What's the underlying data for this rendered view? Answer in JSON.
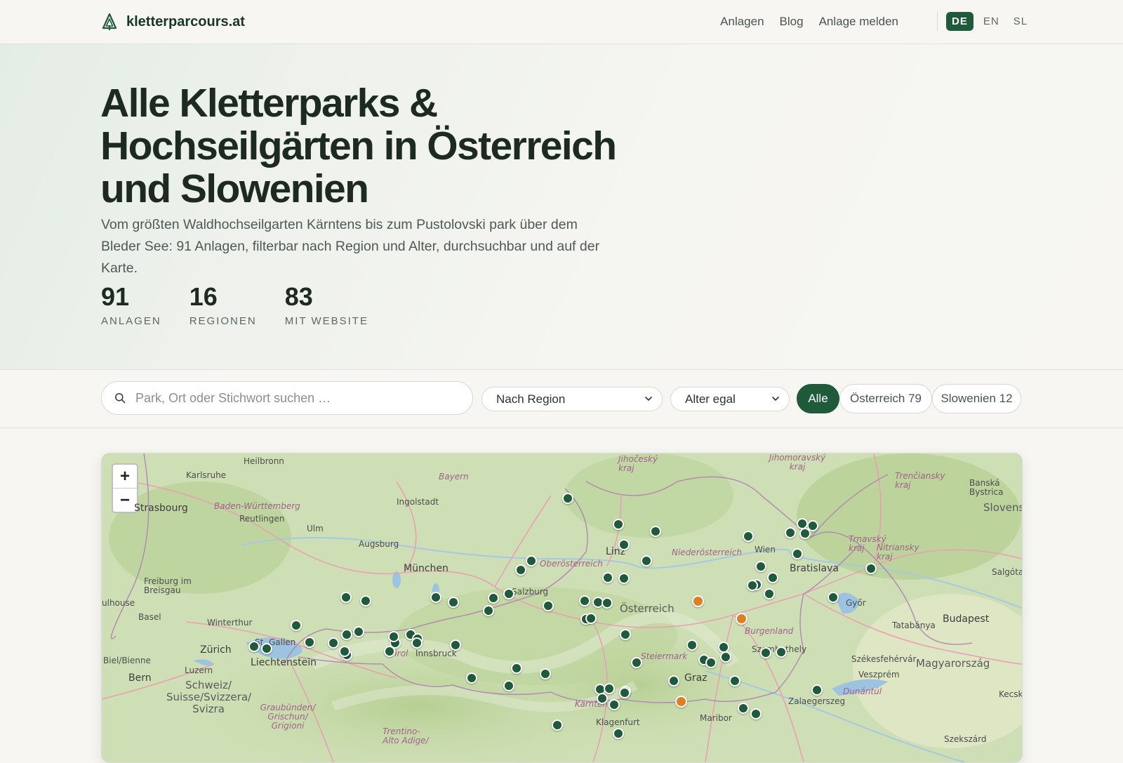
{
  "header": {
    "brand": "kletterparcours.at",
    "nav": [
      "Anlagen",
      "Blog",
      "Anlage melden"
    ],
    "languages": [
      {
        "code": "DE",
        "active": true
      },
      {
        "code": "EN",
        "active": false
      },
      {
        "code": "SL",
        "active": false
      }
    ]
  },
  "hero": {
    "title_line1": "Alle Kletterparks &",
    "title_line2": "Hochseilgärten in Österreich",
    "title_line3": "und Slowenien",
    "subtitle": "Vom größten Waldhochseilgarten Kärntens bis zum Pustolovski park über dem Bleder See: 91 Anlagen, filterbar nach Region und Alter, durchsuchbar und auf der Karte.",
    "stats": [
      {
        "value": "91",
        "label": "ANLAGEN"
      },
      {
        "value": "16",
        "label": "REGIONEN"
      },
      {
        "value": "83",
        "label": "MIT WEBSITE"
      }
    ]
  },
  "filters": {
    "search_placeholder": "Park, Ort oder Stichwort suchen …",
    "region_select": "Nach Region",
    "age_select": "Alter egal",
    "pills": [
      {
        "label": "Alle",
        "active": true
      },
      {
        "label": "Österreich 79",
        "active": false
      },
      {
        "label": "Slowenien 12",
        "active": false
      }
    ]
  },
  "map": {
    "zoom_in": "+",
    "zoom_out": "−",
    "labels": {
      "heilbronn": "Heilbronn",
      "karlsruhe": "Karlsruhe",
      "bayern": "Bayern",
      "ingolstadt": "Ingolstadt",
      "strasbourg": "Strasbourg",
      "bw": "Baden-Württemberg",
      "reutlingen": "Reutlingen",
      "ulm": "Ulm",
      "augsburg": "Augsburg",
      "muenchen": "München",
      "freiburg": "Freiburg im Breisgau",
      "mulhouse": "ulhouse",
      "basel": "Basel",
      "winterthur": "Winterthur",
      "zuerich": "Zürich",
      "stgallen": "St. Gallen",
      "liechtenstein": "Liechtenstein",
      "biel": "Biel/Bienne",
      "luzern": "Luzern",
      "bern": "Bern",
      "schweiz": "Schweiz/ Suisse/Svizzera/ Svizra",
      "graubuenden": "Graubünden/ Grischun/ Grigioni",
      "tirol": "Tirol",
      "innsbruck": "Innsbruck",
      "trentino": "Trentino- Alto Adige/",
      "salzburg": "Salzburg",
      "oberoesterreich": "Oberösterreich",
      "linz": "Linz",
      "oesterreich": "Österreich",
      "steiermark": "Steiermark",
      "graz": "Graz",
      "kaernten": "Kärnten",
      "klagenfurt": "Klagenfurt",
      "niederoesterreich": "Niederösterreich",
      "wien": "Wien",
      "bratislava": "Bratislava",
      "burgenland": "Burgenland",
      "szombathely": "Szombathely",
      "gyor": "Győr",
      "tatabanya": "Tatabánya",
      "budapest": "Budapest",
      "magyarorszag": "Magyarország",
      "szekesfehervar": "Székesfehérvár",
      "veszprem": "Veszprém",
      "dunantul": "Dunántúl",
      "zalaegerszeg": "Zalaegerszeg",
      "maribor": "Maribor",
      "kecskemet": "Kecskem",
      "szekszard": "Szekszárd",
      "jihocesky": "Jihočeský kraj",
      "jihomoravsky": "Jihomoravský kraj",
      "trnavsky": "Trnavský kraj",
      "nitriansky": "Nitriansky kraj",
      "trenciansky": "Trenčiansky kraj",
      "banska": "Banská Bystrica",
      "slovensk": "Slovensk",
      "salgota": "Salgóta"
    },
    "markers": [
      {
        "lon": 13.62,
        "lat": 48.73
      },
      {
        "lon": 14.25,
        "lat": 48.42
      },
      {
        "lon": 14.72,
        "lat": 48.34
      },
      {
        "lon": 14.32,
        "lat": 48.18
      },
      {
        "lon": 13.16,
        "lat": 47.99
      },
      {
        "lon": 14.61,
        "lat": 47.99
      },
      {
        "lon": 13.02,
        "lat": 47.88
      },
      {
        "lon": 14.12,
        "lat": 47.79
      },
      {
        "lon": 14.32,
        "lat": 47.78
      },
      {
        "lon": 15.89,
        "lat": 48.28
      },
      {
        "lon": 16.42,
        "lat": 48.32
      },
      {
        "lon": 16.7,
        "lat": 48.4
      },
      {
        "lon": 16.57,
        "lat": 48.43
      },
      {
        "lon": 16.61,
        "lat": 48.31
      },
      {
        "lon": 16.51,
        "lat": 48.07
      },
      {
        "lon": 16.05,
        "lat": 47.92
      },
      {
        "lon": 16.2,
        "lat": 47.79
      },
      {
        "lon": 16.0,
        "lat": 47.71
      },
      {
        "lon": 15.94,
        "lat": 47.7
      },
      {
        "lon": 16.16,
        "lat": 47.6
      },
      {
        "lon": 16.96,
        "lat": 47.56
      },
      {
        "lon": 17.44,
        "lat": 47.9
      },
      {
        "lon": 10.82,
        "lat": 47.56
      },
      {
        "lon": 11.07,
        "lat": 47.52
      },
      {
        "lon": 11.95,
        "lat": 47.56
      },
      {
        "lon": 12.17,
        "lat": 47.5
      },
      {
        "lon": 12.68,
        "lat": 47.55
      },
      {
        "lon": 12.87,
        "lat": 47.6
      },
      {
        "lon": 13.37,
        "lat": 47.46
      },
      {
        "lon": 13.83,
        "lat": 47.52
      },
      {
        "lon": 14.0,
        "lat": 47.5
      },
      {
        "lon": 14.11,
        "lat": 47.49
      },
      {
        "lon": 12.62,
        "lat": 47.4
      },
      {
        "lon": 13.85,
        "lat": 47.3
      },
      {
        "lon": 13.91,
        "lat": 47.31
      },
      {
        "lon": 14.34,
        "lat": 47.12
      },
      {
        "lon": 10.19,
        "lat": 47.23
      },
      {
        "lon": 10.36,
        "lat": 47.03
      },
      {
        "lon": 9.66,
        "lat": 46.98
      },
      {
        "lon": 9.82,
        "lat": 46.95
      },
      {
        "lon": 10.66,
        "lat": 47.02
      },
      {
        "lon": 10.83,
        "lat": 47.12
      },
      {
        "lon": 10.98,
        "lat": 47.15
      },
      {
        "lon": 11.44,
        "lat": 47.02
      },
      {
        "lon": 11.42,
        "lat": 47.09
      },
      {
        "lon": 11.63,
        "lat": 47.12
      },
      {
        "lon": 11.72,
        "lat": 47.07
      },
      {
        "lon": 11.71,
        "lat": 47.02
      },
      {
        "lon": 10.83,
        "lat": 46.88
      },
      {
        "lon": 10.8,
        "lat": 46.92
      },
      {
        "lon": 11.37,
        "lat": 46.92
      },
      {
        "lon": 12.2,
        "lat": 46.99
      },
      {
        "lon": 15.18,
        "lat": 46.99
      },
      {
        "lon": 15.58,
        "lat": 46.97
      },
      {
        "lon": 15.61,
        "lat": 46.85
      },
      {
        "lon": 15.33,
        "lat": 46.82
      },
      {
        "lon": 15.42,
        "lat": 46.79
      },
      {
        "lon": 16.11,
        "lat": 46.9
      },
      {
        "lon": 16.31,
        "lat": 46.91
      },
      {
        "lon": 14.48,
        "lat": 46.79
      },
      {
        "lon": 12.97,
        "lat": 46.72
      },
      {
        "lon": 13.33,
        "lat": 46.65
      },
      {
        "lon": 12.4,
        "lat": 46.6
      },
      {
        "lon": 12.87,
        "lat": 46.51
      },
      {
        "lon": 14.02,
        "lat": 46.47
      },
      {
        "lon": 14.14,
        "lat": 46.48
      },
      {
        "lon": 14.34,
        "lat": 46.45
      },
      {
        "lon": 14.05,
        "lat": 46.36
      },
      {
        "lon": 14.33,
        "lat": 46.43
      },
      {
        "lon": 14.2,
        "lat": 46.29
      },
      {
        "lon": 14.95,
        "lat": 46.57
      },
      {
        "lon": 15.72,
        "lat": 46.57
      },
      {
        "lon": 15.83,
        "lat": 46.25
      },
      {
        "lon": 15.99,
        "lat": 46.18
      },
      {
        "lon": 16.76,
        "lat": 46.46
      },
      {
        "lon": 13.48,
        "lat": 46.05
      },
      {
        "lon": 14.25,
        "lat": 45.95
      }
    ],
    "markers_orange": [
      {
        "lon": 15.25,
        "lat": 47.52
      },
      {
        "lon": 15.8,
        "lat": 47.31
      },
      {
        "lon": 15.04,
        "lat": 46.33
      }
    ]
  }
}
